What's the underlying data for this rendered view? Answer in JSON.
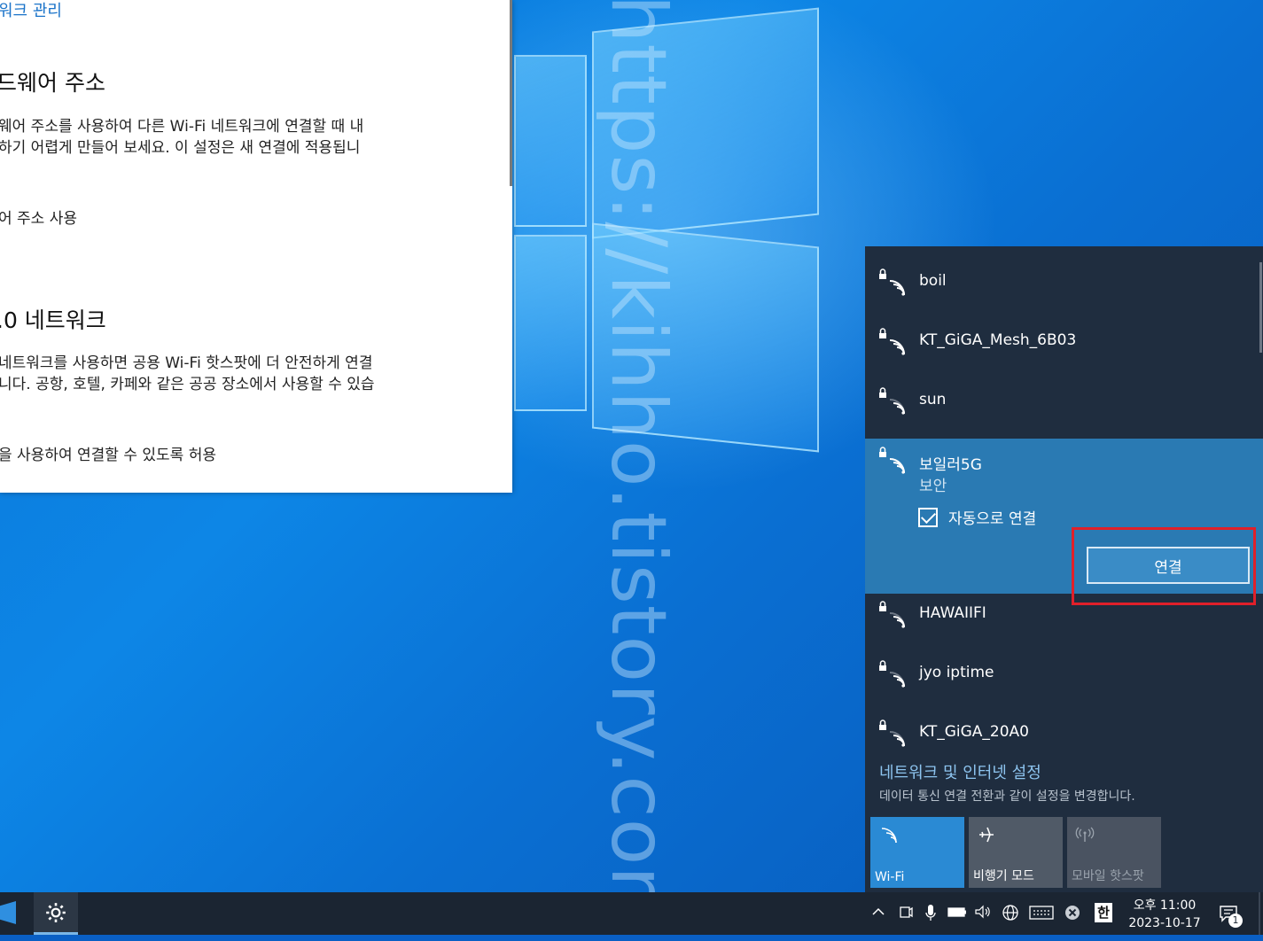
{
  "settings_window": {
    "link": "워크 관리",
    "section1_title": "드웨어 주소",
    "section1_desc1": "웨어 주소를 사용하여 다른 Wi-Fi 네트워크에 연결할 때 내",
    "section1_desc2": "하기 어렵게 만들어 보세요. 이 설정은 새 연결에 적용됩니",
    "section1_toggle_label": "어 주소 사용",
    "section2_title": ".0 네트워크",
    "section2_desc1": "네트워크를 사용하면 공용 Wi-Fi 핫스팟에 더 안전하게 연결",
    "section2_desc2": "니다. 공항, 호텔, 카페와 같은 공공 장소에서 사용할 수 있습",
    "section2_toggle_label": "을 사용하여 연결할 수 있도록 허용"
  },
  "watermark": "https://kihho.tistory.com",
  "network_flyout": {
    "networks": [
      {
        "name": "boil",
        "secured": true
      },
      {
        "name": "KT_GiGA_Mesh_6B03",
        "secured": true
      },
      {
        "name": "sun",
        "secured": true
      },
      {
        "name": "보일러5G",
        "secured": true,
        "status": "보안",
        "selected": true
      },
      {
        "name": "HAWAIIFI",
        "secured": true
      },
      {
        "name": "jyo iptime",
        "secured": true
      },
      {
        "name": "KT_GiGA_20A0",
        "secured": true
      }
    ],
    "auto_connect_label": "자동으로 연결",
    "auto_connect_checked": true,
    "connect_button": "연결",
    "settings_link": "네트워크 및 인터넷 설정",
    "settings_desc": "데이터 통신 연결 전환과 같이 설정을 변경합니다.",
    "quick_actions": [
      {
        "label": "Wi-Fi",
        "icon": "wifi-icon",
        "state": "on"
      },
      {
        "label": "비행기 모드",
        "icon": "airplane-icon",
        "state": "off"
      },
      {
        "label": "모바일 핫스팟",
        "icon": "hotspot-icon",
        "state": "disabled"
      }
    ]
  },
  "taskbar": {
    "clock_period": "오후 11:00",
    "clock_date": "2023-10-17",
    "ime_label": "한",
    "notification_count": "1"
  },
  "colors": {
    "flyout_bg": "#1f2d3f",
    "selected_network_bg": "#2a7ab3",
    "highlight_box": "#e0202a",
    "accent": "#2a8ad4"
  }
}
